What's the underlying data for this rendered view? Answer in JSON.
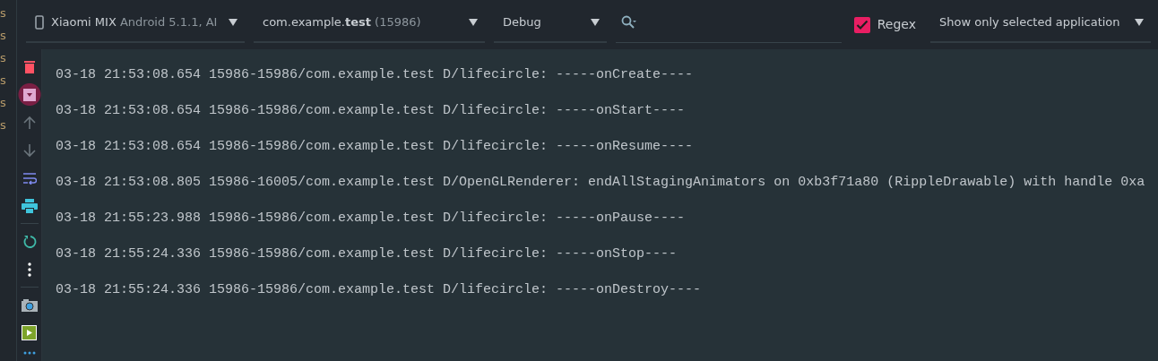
{
  "edge_strip": {
    "items": [
      "s",
      "s",
      "s",
      "s",
      "s",
      "s"
    ]
  },
  "toolbar": {
    "device": {
      "name": "Xiaomi MIX",
      "detail": "Android 5.1.1, AI"
    },
    "process": {
      "package": "com.example.",
      "package_bold": "test",
      "pid": "(15986)"
    },
    "level": "Debug",
    "regex": {
      "label": "Regex",
      "checked": true
    },
    "filter": "Show only selected application"
  },
  "side_tools": [
    {
      "kind": "trash"
    },
    {
      "kind": "scroll-end",
      "selected": true
    },
    {
      "kind": "up"
    },
    {
      "kind": "down"
    },
    {
      "kind": "wrap"
    },
    {
      "kind": "print"
    },
    {
      "kind": "sep"
    },
    {
      "kind": "restart"
    },
    {
      "kind": "more"
    },
    {
      "kind": "sep"
    },
    {
      "kind": "camera"
    },
    {
      "kind": "record"
    },
    {
      "kind": "dots"
    }
  ],
  "log_lines": [
    "03-18 21:53:08.654 15986-15986/com.example.test D/lifecircle: -----onCreate----",
    "03-18 21:53:08.654 15986-15986/com.example.test D/lifecircle: -----onStart----",
    "03-18 21:53:08.654 15986-15986/com.example.test D/lifecircle: -----onResume----",
    "03-18 21:53:08.805 15986-16005/com.example.test D/OpenGLRenderer: endAllStagingAnimators on 0xb3f71a80 (RippleDrawable) with handle 0xa",
    "03-18 21:55:23.988 15986-15986/com.example.test D/lifecircle: -----onPause----",
    "03-18 21:55:24.336 15986-15986/com.example.test D/lifecircle: -----onStop----",
    "03-18 21:55:24.336 15986-15986/com.example.test D/lifecircle: -----onDestroy----"
  ]
}
